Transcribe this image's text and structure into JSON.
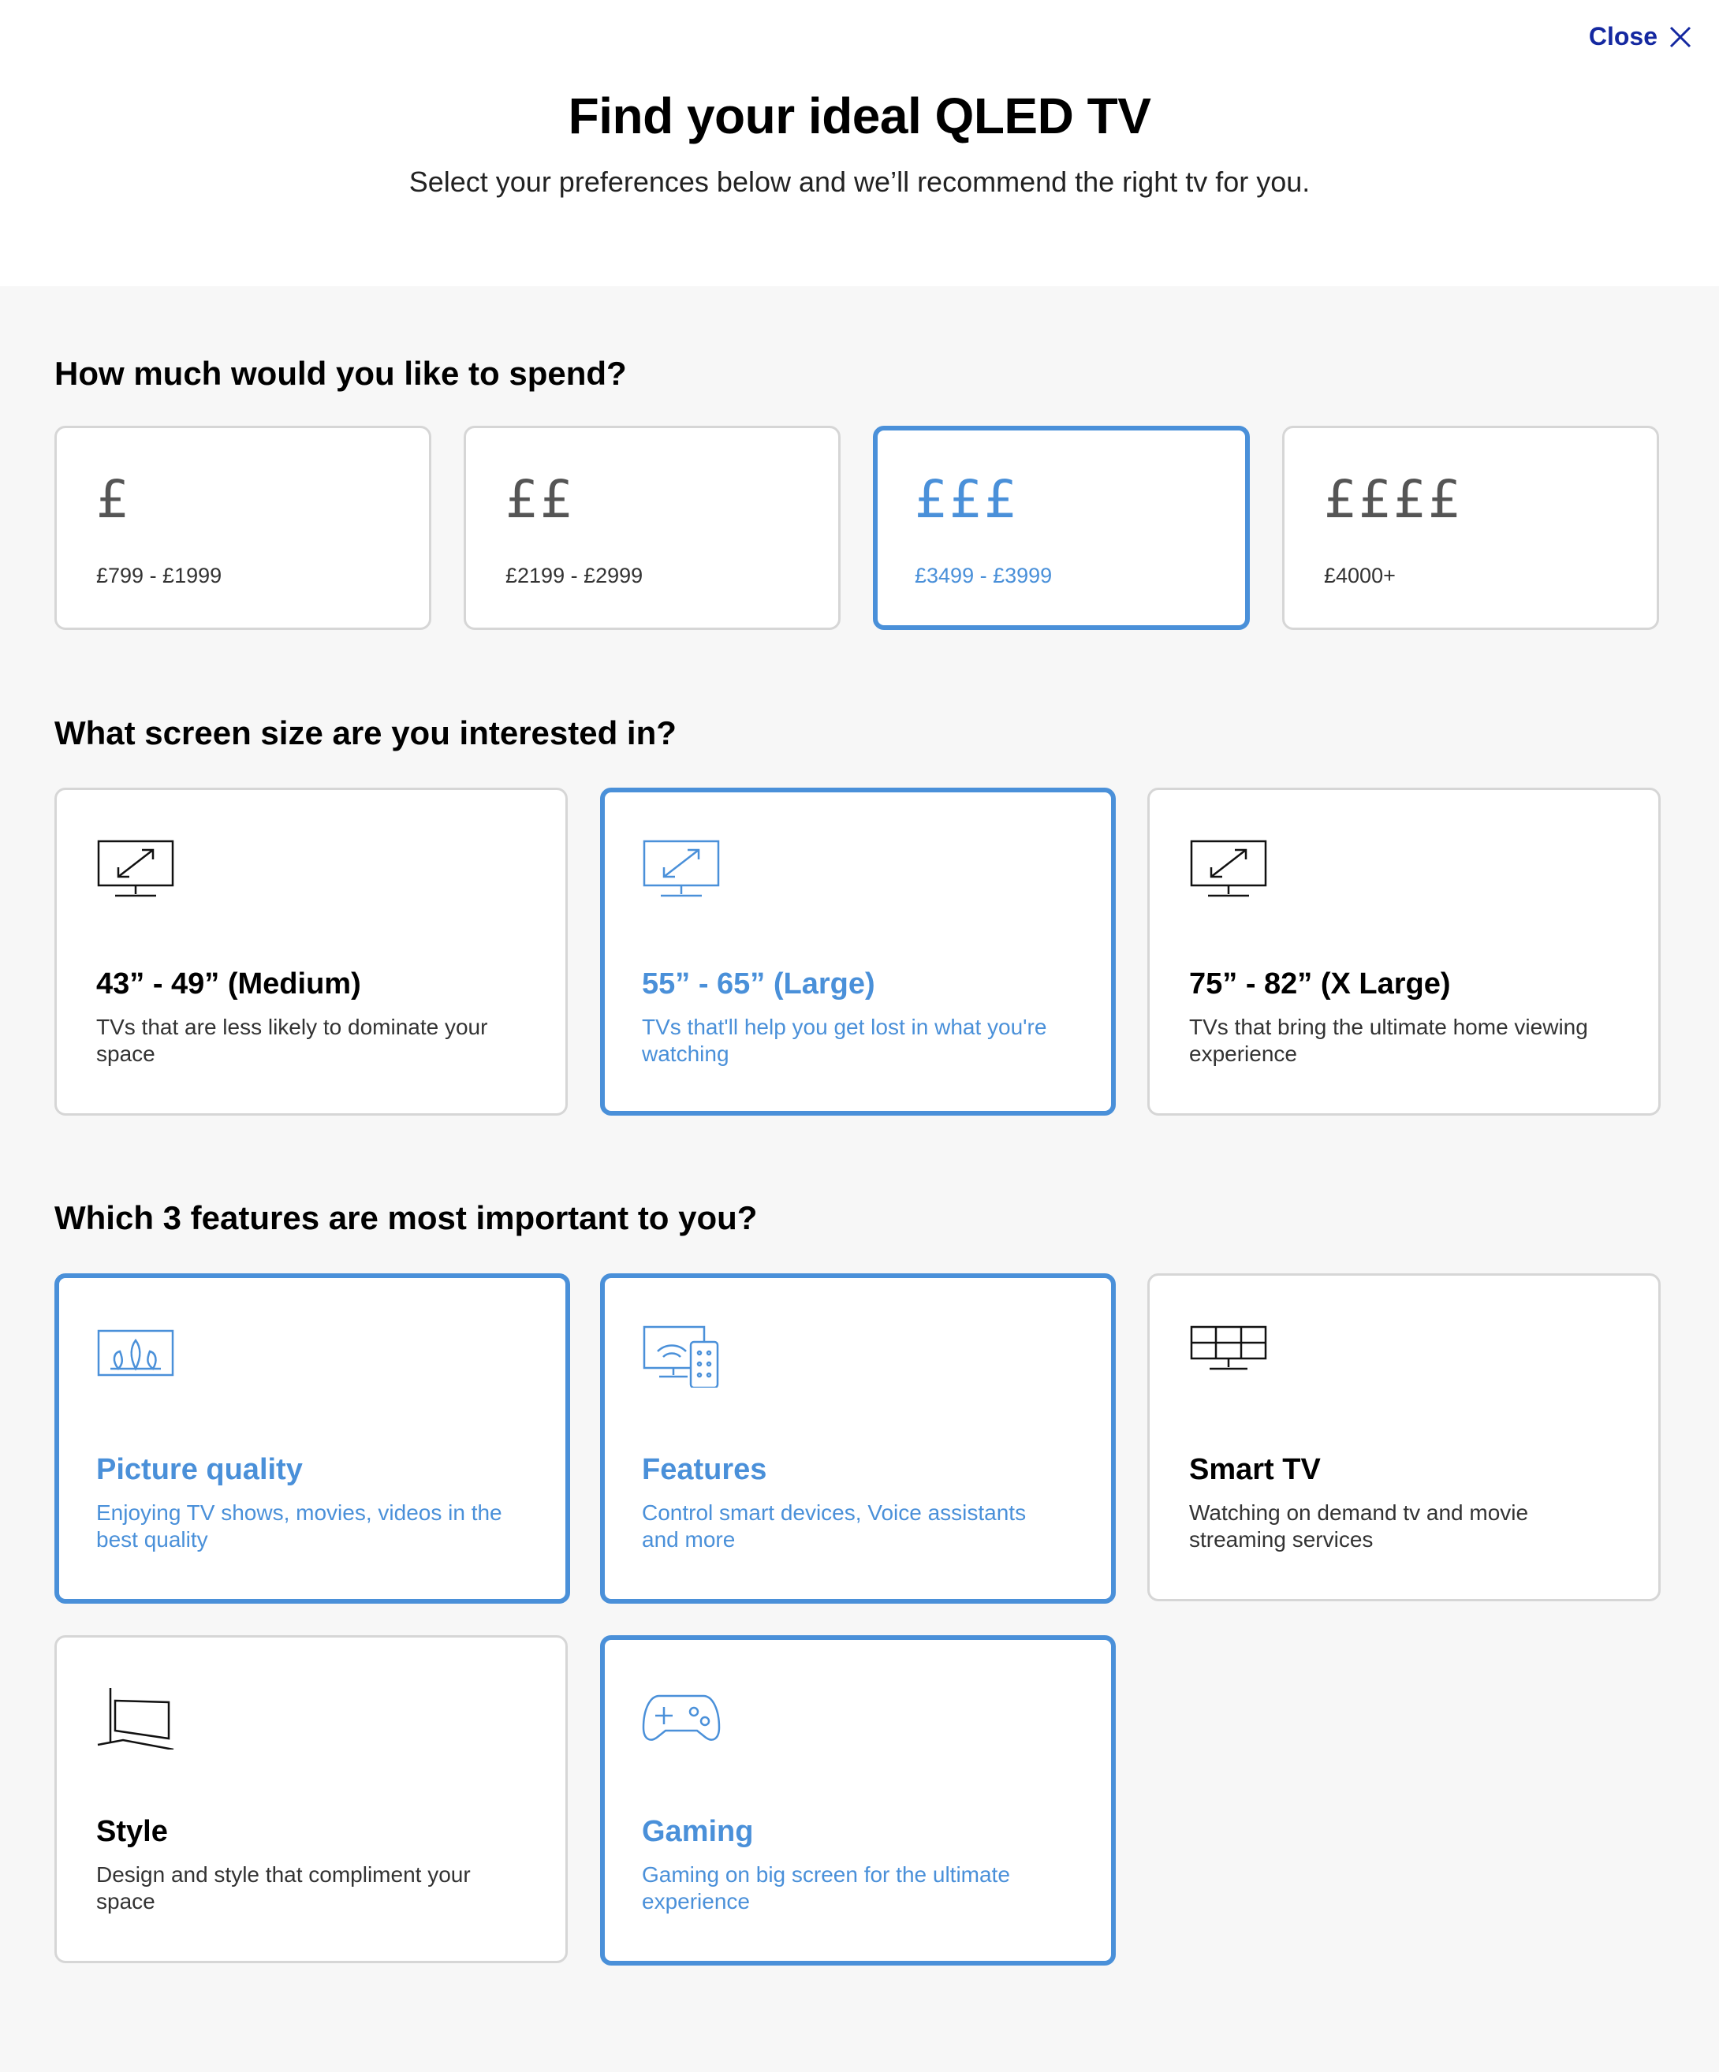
{
  "close": {
    "label": "Close"
  },
  "header": {
    "title": "Find your ideal QLED TV",
    "subtitle": "Select your preferences below and we’ll recommend the right tv for you."
  },
  "budget": {
    "question": "How much would you like to spend?",
    "options": [
      {
        "symbol": "£",
        "range": "£799 - £1999",
        "selected": false
      },
      {
        "symbol": "££",
        "range": "£2199 - £2999",
        "selected": false
      },
      {
        "symbol": "£££",
        "range": "£3499 - £3999",
        "selected": true
      },
      {
        "symbol": "££££",
        "range": "£4000+",
        "selected": false
      }
    ]
  },
  "size": {
    "question": "What screen size are you interested in?",
    "options": [
      {
        "icon": "tv-resize-icon",
        "label": "43” - 49” (Medium)",
        "desc": "TVs that are less likely to dominate your space",
        "selected": false
      },
      {
        "icon": "tv-resize-icon",
        "label": "55” - 65” (Large)",
        "desc": "TVs that'll help you get lost in what you're watching",
        "selected": true
      },
      {
        "icon": "tv-resize-icon",
        "label": "75” - 82” (X Large)",
        "desc": "TVs that bring the ultimate home viewing experience",
        "selected": false
      }
    ]
  },
  "features": {
    "question": "Which 3 features are most important to you?",
    "options": [
      {
        "icon": "picture-quality-icon",
        "label": "Picture quality",
        "desc": "Enjoying TV shows, movies, videos in the best quality",
        "selected": true
      },
      {
        "icon": "smart-devices-icon",
        "label": "Features",
        "desc": "Control smart devices, Voice assistants and more",
        "selected": true
      },
      {
        "icon": "smart-tv-icon",
        "label": "Smart TV",
        "desc": "Watching on demand tv and movie streaming services",
        "selected": false
      },
      {
        "icon": "style-icon",
        "label": "Style",
        "desc": "Design and style that compliment your space",
        "selected": false
      },
      {
        "icon": "gamepad-icon",
        "label": "Gaming",
        "desc": "Gaming on big screen for the ultimate experience",
        "selected": true
      }
    ]
  },
  "colors": {
    "accent": "#4a90d9",
    "close": "#1428a0",
    "border": "#d6d6d6",
    "background": "#f7f7f7"
  }
}
